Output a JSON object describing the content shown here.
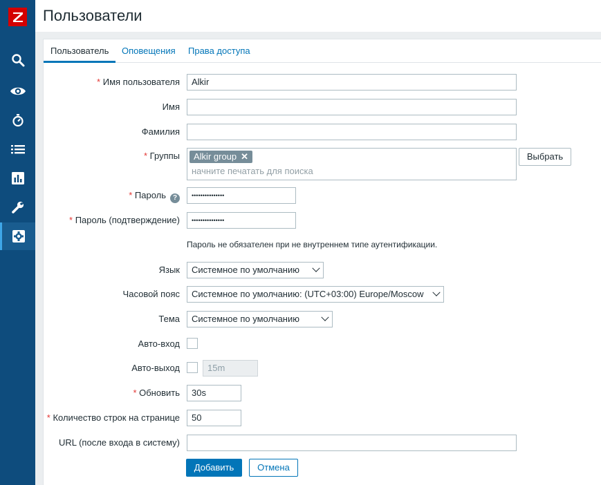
{
  "app": {
    "logo_letter": "Z",
    "logo_color": "#d40000",
    "sidebar_color": "#0e4c7d",
    "accent": "#0275b8"
  },
  "sidebar": {
    "items": [
      {
        "icon": "search-icon"
      },
      {
        "icon": "eye-icon"
      },
      {
        "icon": "stopwatch-icon"
      },
      {
        "icon": "list-icon"
      },
      {
        "icon": "bar-chart-icon"
      },
      {
        "icon": "wrench-icon"
      },
      {
        "icon": "gear-icon",
        "active": true
      }
    ]
  },
  "header": {
    "title": "Пользователи"
  },
  "tabs": [
    {
      "label": "Пользователь",
      "active": true
    },
    {
      "label": "Оповещения"
    },
    {
      "label": "Права доступа"
    }
  ],
  "form": {
    "required_mark": "*",
    "username": {
      "label": "Имя пользователя",
      "value": "Alkir"
    },
    "name": {
      "label": "Имя",
      "value": ""
    },
    "surname": {
      "label": "Фамилия",
      "value": ""
    },
    "groups": {
      "label": "Группы",
      "tag": "Alkir group",
      "tag_remove": "✕",
      "placeholder": "начните печатать для поиска",
      "select_button": "Выбрать"
    },
    "password": {
      "label": "Пароль",
      "help": "?",
      "value": "•••••••••••••••"
    },
    "password_confirm": {
      "label": "Пароль (подтверждение)",
      "value": "•••••••••••••••"
    },
    "password_note": "Пароль не обязателен при не внутреннем типе аутентификации.",
    "language": {
      "label": "Язык",
      "value": "Системное по умолчанию"
    },
    "timezone": {
      "label": "Часовой пояс",
      "value": "Системное по умолчанию: (UTC+03:00) Europe/Moscow"
    },
    "theme": {
      "label": "Тема",
      "value": "Системное по умолчанию"
    },
    "autologin": {
      "label": "Авто-вход",
      "checked": false
    },
    "autologout": {
      "label": "Авто-выход",
      "checked": false,
      "value": "15m"
    },
    "refresh": {
      "label": "Обновить",
      "value": "30s"
    },
    "rows_per_page": {
      "label": "Количество строк на странице",
      "value": "50"
    },
    "url": {
      "label": "URL (после входа в систему)",
      "value": ""
    },
    "add_button": "Добавить",
    "cancel_button": "Отмена"
  }
}
